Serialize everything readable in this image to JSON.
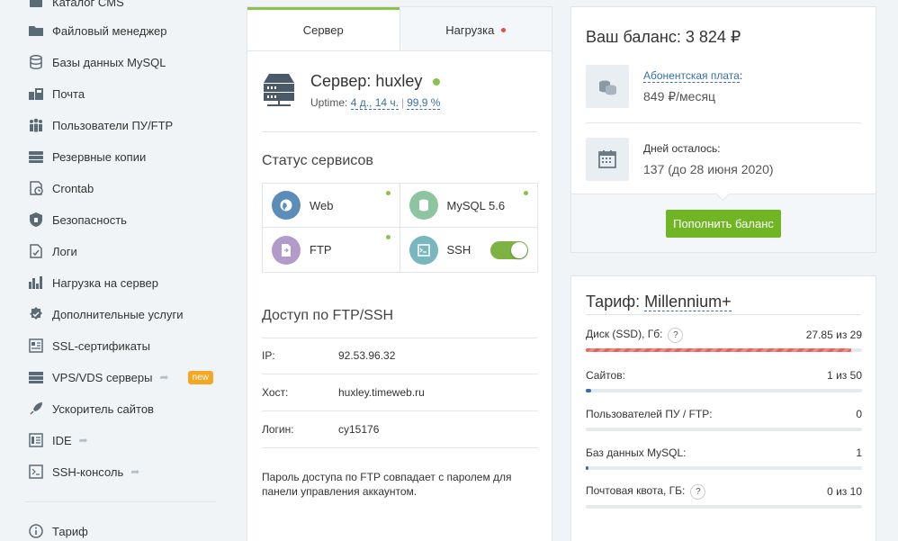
{
  "sidebar": {
    "items": [
      {
        "label": "Каталог CMS",
        "icon": "catalog-icon"
      },
      {
        "label": "Файловый менеджер",
        "icon": "folder-icon"
      },
      {
        "label": "Базы данных MySQL",
        "icon": "database-icon"
      },
      {
        "label": "Почта",
        "icon": "mail-icon"
      },
      {
        "label": "Пользователи ПУ/FTP",
        "icon": "users-icon"
      },
      {
        "label": "Резервные копии",
        "icon": "backup-icon"
      },
      {
        "label": "Crontab",
        "icon": "crontab-icon"
      },
      {
        "label": "Безопасность",
        "icon": "shield-icon"
      },
      {
        "label": "Логи",
        "icon": "logs-icon"
      },
      {
        "label": "Нагрузка на сервер",
        "icon": "chart-icon"
      },
      {
        "label": "Дополнительные услуги",
        "icon": "services-icon"
      },
      {
        "label": "SSL-сертификаты",
        "icon": "certificate-icon"
      },
      {
        "label": "VPS/VDS серверы",
        "icon": "vps-icon",
        "badge": "new"
      },
      {
        "label": "Ускоритель сайтов",
        "icon": "rocket-icon"
      },
      {
        "label": "IDE",
        "icon": "ide-icon"
      },
      {
        "label": "SSH-консоль",
        "icon": "console-icon"
      },
      {
        "label": "Тариф",
        "icon": "info-icon"
      }
    ]
  },
  "server_panel": {
    "tabs": [
      {
        "label": "Сервер"
      },
      {
        "label": "Нагрузка"
      }
    ],
    "server_label": "Сервер: huxley",
    "uptime_label": "Uptime:",
    "uptime_value": "4 д., 14 ч.",
    "uptime_percent": "99,9 %",
    "services_title": "Статус сервисов",
    "services": [
      {
        "label": "Web",
        "icon": "web-icon"
      },
      {
        "label": "MySQL 5.6",
        "icon": "mysql-icon"
      },
      {
        "label": "FTP",
        "icon": "ftp-icon"
      },
      {
        "label": "SSH",
        "icon": "ssh-icon"
      }
    ],
    "access_title": "Доступ по FTP/SSH",
    "access": [
      {
        "key": "IP:",
        "value": "92.53.96.32"
      },
      {
        "key": "Хост:",
        "value": "huxley.timeweb.ru"
      },
      {
        "key": "Логин:",
        "value": "cy15176"
      }
    ],
    "note": "Пароль доступа по FTP совпадает с паролем для панели управления аккаунтом."
  },
  "balance_panel": {
    "title": "Ваш баланс: 3 824 ₽",
    "fee_label": "Абонентская плата",
    "fee_colon": ":",
    "fee_value": "849 ₽/месяц",
    "days_label": "Дней осталось:",
    "days_value": "137 (до 28 июня 2020)",
    "topup_button": "Пополнить баланс"
  },
  "tariff_panel": {
    "title_prefix": "Тариф: ",
    "title_name": "Millennium+",
    "help_glyph": "?",
    "metrics": [
      {
        "label": "Диск (SSD), Гб:",
        "value": "27.85 из 29",
        "help": true,
        "fraction": 0.96
      },
      {
        "label": "Сайтов:",
        "value": "1 из 50",
        "help": false,
        "fraction": 0.02
      },
      {
        "label": "Пользователей ПУ / FTP:",
        "value": "0",
        "help": false,
        "fraction": 0
      },
      {
        "label": "Баз данных MySQL:",
        "value": "1",
        "help": false,
        "fraction": 0.01
      },
      {
        "label": "Почтовая квота, ГБ:",
        "value": "0 из 10",
        "help": true,
        "fraction": 0
      }
    ]
  },
  "colors": {
    "accent_green": "#8bc34a",
    "button_green": "#6fb524",
    "link_blue": "#3a6fa8",
    "alert_red": "#e74c3c",
    "badge_orange": "#f5a623"
  }
}
